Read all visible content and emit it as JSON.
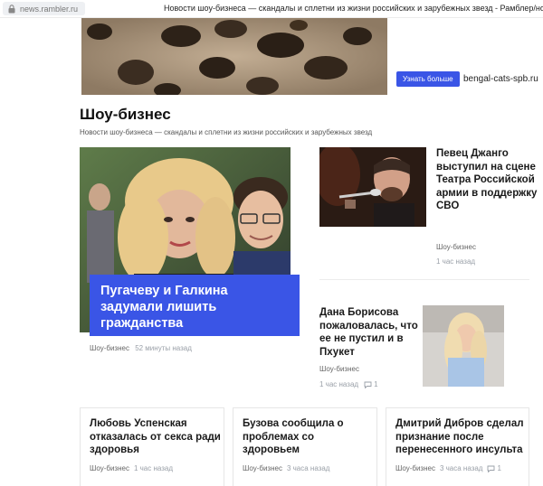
{
  "browser": {
    "url": "news.rambler.ru",
    "tab_title": "Новости шоу-бизнеса — скандалы и сплетни из жизни российских и зарубежных звезд - Рамблер/новости"
  },
  "ad": {
    "cta_label": "Узнать больше",
    "domain": "bengal-cats-spb.ru"
  },
  "section": {
    "title": "Шоу-бизнес",
    "subtitle": "Новости шоу-бизнеса — скандалы и сплетни из жизни российских и зарубежных звезд"
  },
  "main_story": {
    "headline": "Пугачеву и Галкина задумали лишить гражданства",
    "category": "Шоу-бизнес",
    "time": "52 минуты назад"
  },
  "right_stories": [
    {
      "headline": "Певец Джанго выступил на сцене Театра Российской армии в поддержку СВО",
      "category": "Шоу-бизнес",
      "time": "1 час назад"
    },
    {
      "headline": "Дана Борисова пожаловалась, что ее не пустил и в Пхукет",
      "category": "Шоу-бизнес",
      "time": "1 час назад",
      "comments": "1"
    }
  ],
  "cards": [
    {
      "headline": "Любовь Успенская отказалась от секса ради здоровья",
      "category": "Шоу-бизнес",
      "time": "1 час назад"
    },
    {
      "headline": "Бузова сообщила о проблемах со здоровьем",
      "category": "Шоу-бизнес",
      "time": "3 часа назад"
    },
    {
      "headline": "Дмитрий Дибров сделал признание после перенесенного инсульта",
      "category": "Шоу-бизнес",
      "time": "3 часа назад",
      "comments": "1"
    }
  ],
  "colors": {
    "accent": "#3a55e6",
    "muted": "#9aa0a8"
  },
  "icons": [
    "lock-icon",
    "comment-icon"
  ]
}
